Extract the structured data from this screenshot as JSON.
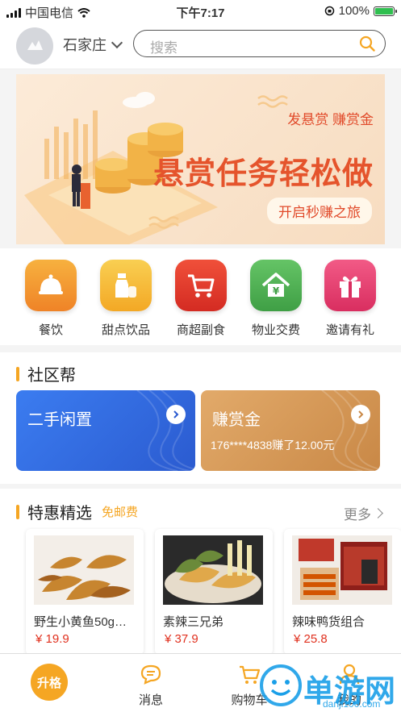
{
  "status_bar": {
    "carrier": "中国电信",
    "time": "下午7:17",
    "battery": "100%"
  },
  "header": {
    "city": "石家庄",
    "search_placeholder": "搜索"
  },
  "banner": {
    "tagline": "发悬赏 赚赏金",
    "headline": "悬赏任务轻松做",
    "cta": "开启秒赚之旅"
  },
  "categories": [
    {
      "label": "餐饮",
      "icon": "food-cloche-icon",
      "color": "#f29a2e"
    },
    {
      "label": "甜点饮品",
      "icon": "milk-bottle-icon",
      "color": "#f7b733"
    },
    {
      "label": "商超副食",
      "icon": "shopping-cart-icon",
      "color": "#e8412f"
    },
    {
      "label": "物业交费",
      "icon": "house-yen-icon",
      "color": "#4caf50"
    },
    {
      "label": "邀请有礼",
      "icon": "gift-icon",
      "color": "#e63c6e"
    }
  ],
  "community": {
    "title": "社区帮",
    "cards": [
      {
        "title": "二手闲置",
        "subtitle": "",
        "color": "#2f6fe0"
      },
      {
        "title": "赚赏金",
        "subtitle": "176****4838赚了12.00元",
        "color": "#d79a5a"
      }
    ]
  },
  "deals": {
    "title": "特惠精选",
    "badge": "免邮费",
    "more": "更多",
    "products": [
      {
        "name": "野生小黄鱼50g…",
        "price": "¥ 19.9"
      },
      {
        "name": "素辣三兄弟",
        "price": "¥ 37.9"
      },
      {
        "name": "辣味鸭货组合",
        "price": "¥ 25.8"
      }
    ]
  },
  "tabbar": {
    "home": "升格",
    "items": [
      {
        "label": "消息",
        "icon": "chat-bubble-icon"
      },
      {
        "label": "购物车",
        "icon": "cart-icon"
      },
      {
        "label": "我的",
        "icon": "user-icon"
      }
    ]
  },
  "watermark": {
    "text": "单游网",
    "url": "danji100.com"
  },
  "colors": {
    "accent": "#f5a623",
    "price": "#e0301e"
  }
}
